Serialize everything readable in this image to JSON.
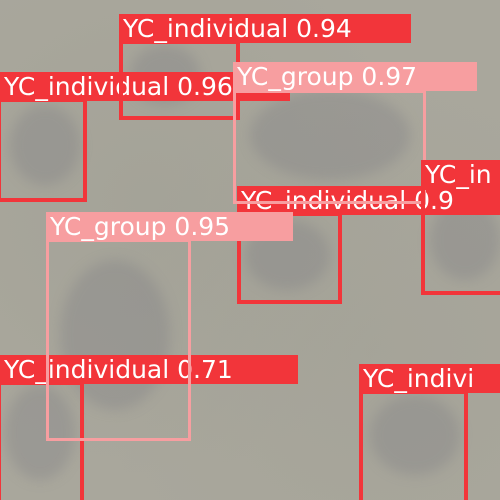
{
  "colors": {
    "individual": "#f2353a",
    "group": "#f79ea0"
  },
  "detections": [
    {
      "id": "d1",
      "class": "YC_individual",
      "score": "0.94",
      "text": "YC_individual 0.94"
    },
    {
      "id": "d2",
      "class": "YC_individual",
      "score": "0.96",
      "text": "YC_individual 0.96"
    },
    {
      "id": "d3",
      "class": "YC_group",
      "score": "0.97",
      "text": "YC_group 0.97"
    },
    {
      "id": "d4",
      "class": "YC_individual",
      "score": "0.9",
      "text": "YC_individual 0.9"
    },
    {
      "id": "d5",
      "class": "YC_individual",
      "score": "",
      "text": "YC_in"
    },
    {
      "id": "d6",
      "class": "YC_group",
      "score": "0.95",
      "text": "YC_group 0.95"
    },
    {
      "id": "d7",
      "class": "YC_individual",
      "score": "0.71",
      "text": "YC_individual 0.71"
    },
    {
      "id": "d8",
      "class": "YC_individual",
      "score": "",
      "text": "YC_indivi"
    }
  ]
}
